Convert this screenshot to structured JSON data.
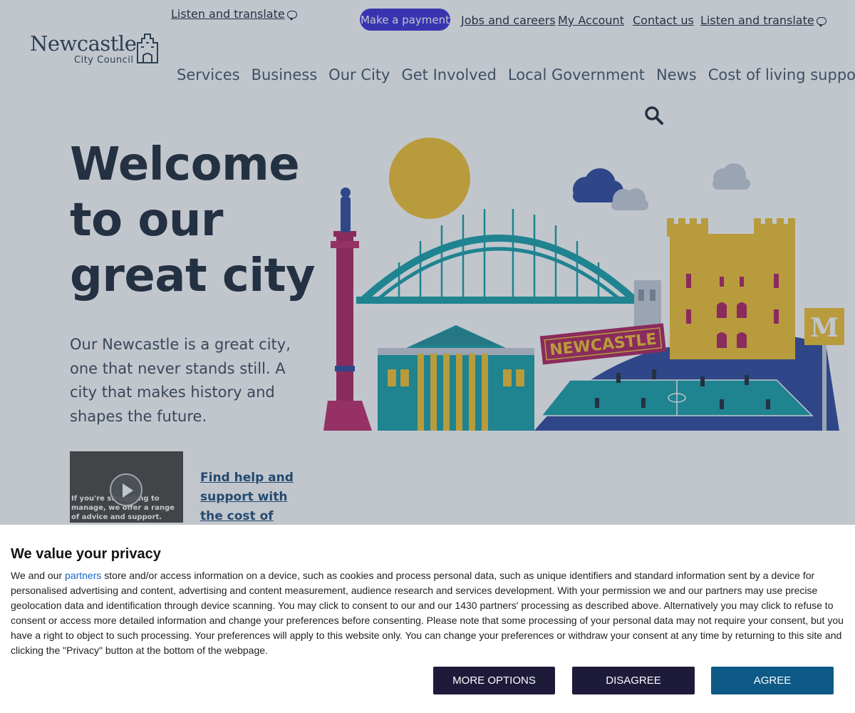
{
  "header": {
    "listen_translate_label": "Listen and translate",
    "make_payment_label": "Make a payment",
    "utility_links": [
      "Jobs and careers",
      "My Account",
      "Contact us",
      "Listen and translate"
    ],
    "logo": {
      "name": "Newcastle",
      "subtitle": "City Council"
    },
    "main_nav": [
      "Services",
      "Business",
      "Our City",
      "Get Involved",
      "Local Government",
      "News",
      "Cost of living support"
    ],
    "search_icon": "search-icon"
  },
  "hero": {
    "title": "Welcome to our great city",
    "text": "Our Newcastle is a great city, one that never stands still. A city that makes history and shapes the future.",
    "illustration_sign": "NEWCASTLE",
    "metro_letter": "M",
    "video_caption": "If you're struggling to manage, we offer a range of advice and support.",
    "help_link": "Find help and support with the cost of living crisis"
  },
  "consent": {
    "title": "We value your privacy",
    "body_prefix": "We and our ",
    "partners_link": "partners",
    "body_rest": " store and/or access information on a device, such as cookies and process personal data, such as unique identifiers and standard information sent by a device for personalised advertising and content, advertising and content measurement, audience research and services development. With your permission we and our partners may use precise geolocation data and identification through device scanning. You may click to consent to our and our 1430 partners' processing as described above. Alternatively you may click to refuse to consent or access more detailed information and change your preferences before consenting. Please note that some processing of your personal data may not require your consent, but you have a right to object to such processing. Your preferences will apply to this website only. You can change your preferences or withdraw your consent at any time by returning to this site and clicking the \"Privacy\" button at the bottom of the webpage.",
    "buttons": {
      "more_options": "MORE OPTIONS",
      "disagree": "DISAGREE",
      "agree": "AGREE"
    }
  },
  "colors": {
    "payment_button": "#3c2fd6",
    "agree_button": "#0d5a86",
    "dark_button": "#1e1b3a",
    "link_blue": "#1a66c9"
  }
}
